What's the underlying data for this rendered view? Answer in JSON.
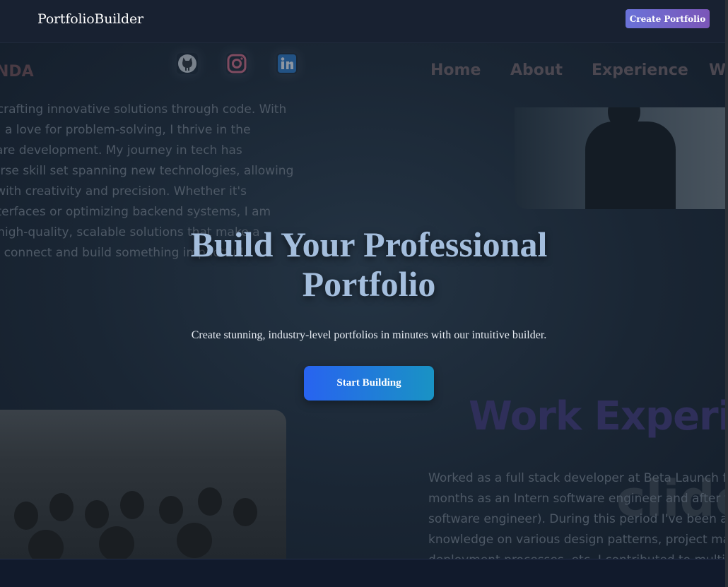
{
  "navbar": {
    "brand": "PortfolioBuilder",
    "create_button": "Create Portfolio"
  },
  "hero": {
    "title_line1": "Build Your Professional",
    "title_line2": "Portfolio",
    "subtitle": "Create stunning, industry-level portfolios in minutes with our intuitive builder.",
    "cta": "Start Building"
  },
  "preview": {
    "logo": "NDA",
    "nav": [
      "Home",
      "About",
      "Experience",
      "W"
    ],
    "social_icons": [
      "github-icon",
      "instagram-icon",
      "linkedin-icon"
    ],
    "about_lines": [
      "o crafting innovative solutions through code. With",
      "nd a love for problem-solving, I thrive in the",
      "ware development. My journey in tech has",
      "verse skill set spanning new technologies, allowing",
      "s with creativity and precision. Whether it's",
      "interfaces or optimizing backend systems, I am",
      "g high-quality, scalable solutions that make a",
      "t's connect and build something impactful!"
    ],
    "work_title": "Work Experi",
    "work_lines": [
      "Worked as a full stack developer at Beta Launch for",
      "months as an Intern software engineer and after th",
      "software engineer). During this period I've been ab",
      "knowledge on various design patterns, project man",
      "deployment processes, etc. I contributed to multip"
    ],
    "watermark": "clide"
  },
  "colors": {
    "navbar_bg": "#182131",
    "create_button": "#6a72d8",
    "hero_title": "#a4bedd",
    "cta_start": "#2863f0",
    "cta_end": "#1993c4",
    "footer_bg": "#111a2c"
  }
}
